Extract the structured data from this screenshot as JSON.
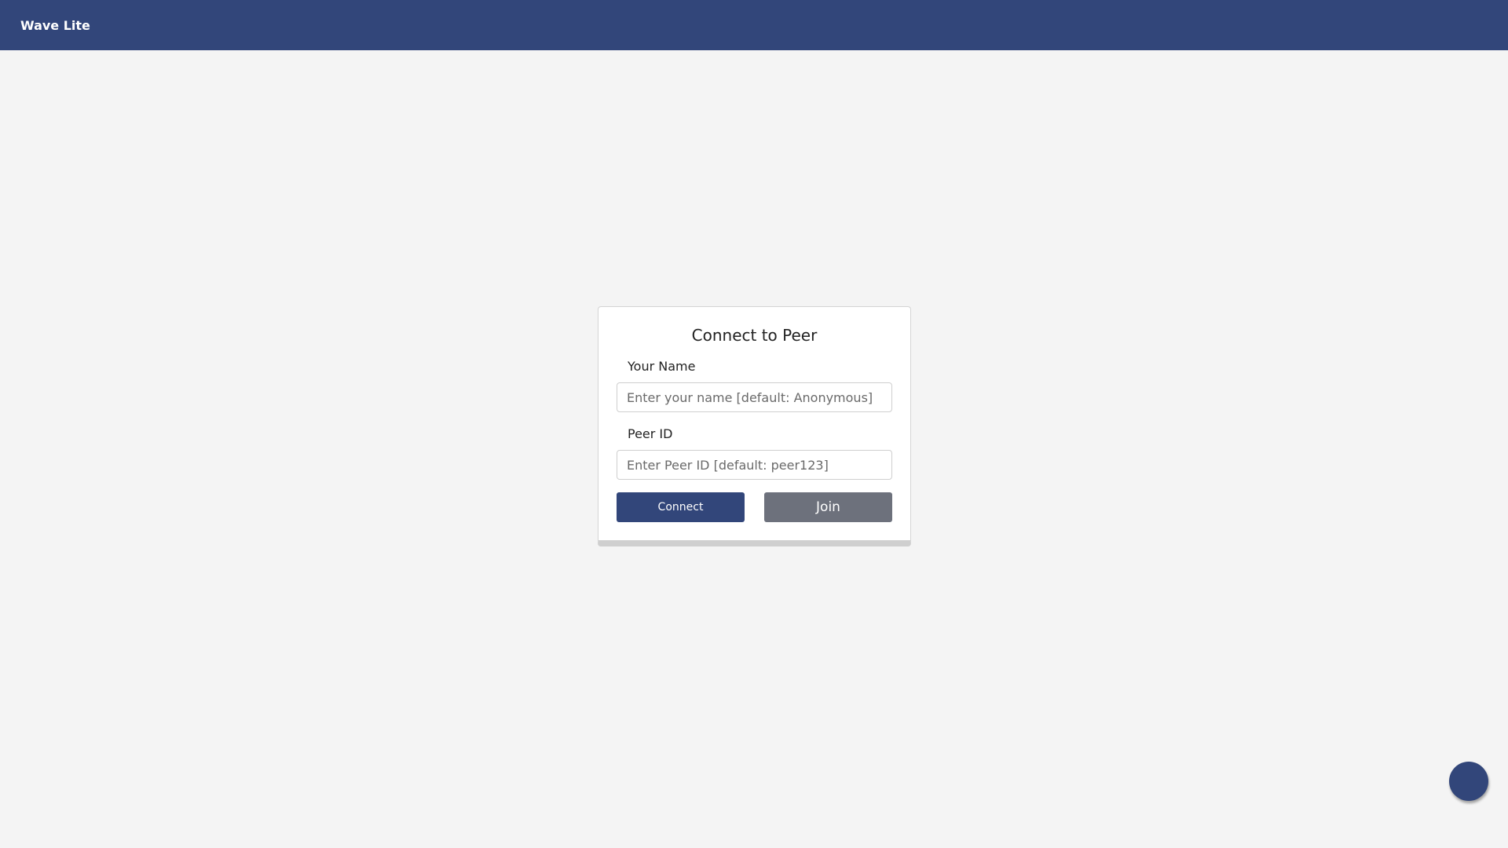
{
  "header": {
    "app_title": "Wave Lite"
  },
  "connect_card": {
    "title": "Connect to Peer",
    "name_label": "Your Name",
    "name_placeholder": "Enter your name [default: Anonymous]",
    "name_value": "",
    "peer_label": "Peer ID",
    "peer_placeholder": "Enter Peer ID [default: peer123]",
    "peer_value": "",
    "connect_label": "Connect",
    "join_label": "Join"
  },
  "colors": {
    "brand": "#32467a",
    "background": "#f4f4f4",
    "secondary_button": "#6d717c"
  },
  "floating_button": {
    "icon": "chat-bubble-icon"
  }
}
